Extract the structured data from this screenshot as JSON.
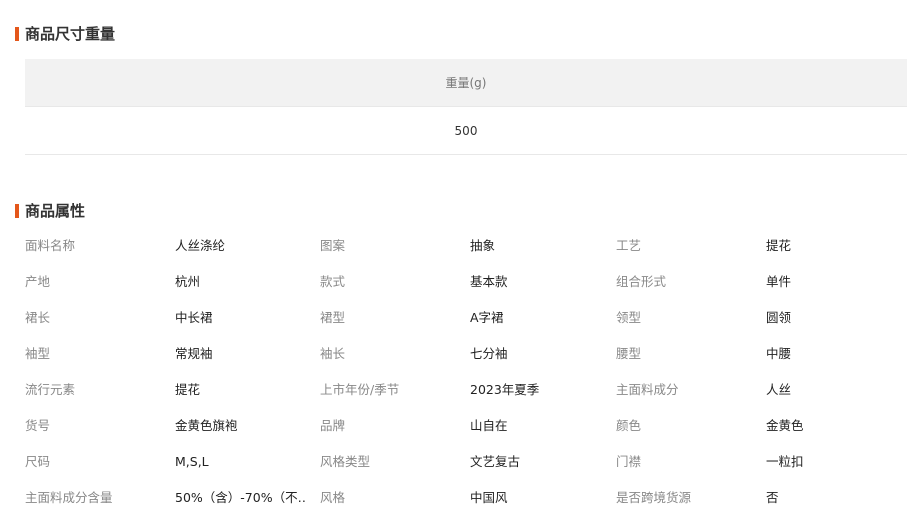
{
  "size_section": {
    "title": "商品尺寸重量",
    "header": "重量(g)",
    "value": "500"
  },
  "attr_section": {
    "title": "商品属性",
    "rows": [
      [
        [
          "面料名称",
          "人丝涤纶"
        ],
        [
          "图案",
          "抽象"
        ],
        [
          "工艺",
          "提花"
        ]
      ],
      [
        [
          "产地",
          "杭州"
        ],
        [
          "款式",
          "基本款"
        ],
        [
          "组合形式",
          "单件"
        ]
      ],
      [
        [
          "裙长",
          "中长裙"
        ],
        [
          "裙型",
          "A字裙"
        ],
        [
          "领型",
          "圆领"
        ]
      ],
      [
        [
          "袖型",
          "常规袖"
        ],
        [
          "袖长",
          "七分袖"
        ],
        [
          "腰型",
          "中腰"
        ]
      ],
      [
        [
          "流行元素",
          "提花"
        ],
        [
          "上市年份/季节",
          "2023年夏季"
        ],
        [
          "主面料成分",
          "人丝"
        ]
      ],
      [
        [
          "货号",
          "金黄色旗袍"
        ],
        [
          "品牌",
          "山自在"
        ],
        [
          "颜色",
          "金黄色"
        ]
      ],
      [
        [
          "尺码",
          "M,S,L"
        ],
        [
          "风格类型",
          "文艺复古"
        ],
        [
          "门襟",
          "一粒扣"
        ]
      ],
      [
        [
          "主面料成分含量",
          "50%（含）-70%（不…"
        ],
        [
          "风格",
          "中国风"
        ],
        [
          "是否跨境货源",
          "否"
        ]
      ]
    ]
  },
  "colors": {
    "accent": "#e4571b",
    "header_bg": "#f2f2f2",
    "label": "#888888",
    "value": "#222222"
  }
}
